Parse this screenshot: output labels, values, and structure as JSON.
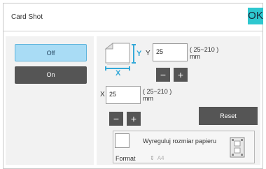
{
  "header": {
    "title": "Card Shot",
    "ok_label": "OK"
  },
  "toggle": {
    "off_label": "Off",
    "on_label": "On",
    "selected": "Off"
  },
  "y_axis": {
    "label": "Y",
    "value": "25",
    "range": "( 25~210 )",
    "unit": "mm"
  },
  "x_axis": {
    "label": "X",
    "value": "25",
    "range": "( 25~210 )",
    "unit": "mm"
  },
  "icons": {
    "card_icon_x": "X",
    "card_icon_y": "Y"
  },
  "stepper": {
    "minus": "−",
    "plus": "+"
  },
  "reset_label": "Reset",
  "paper": {
    "checkbox_label": "Wyreguluj rozmiar papieru",
    "checked": false,
    "format_label": "Format",
    "format_value": "A4"
  },
  "colors": {
    "accent": "#2ec7cf",
    "selected_toggle": "#a9dcf5",
    "dark_button": "#555555"
  }
}
